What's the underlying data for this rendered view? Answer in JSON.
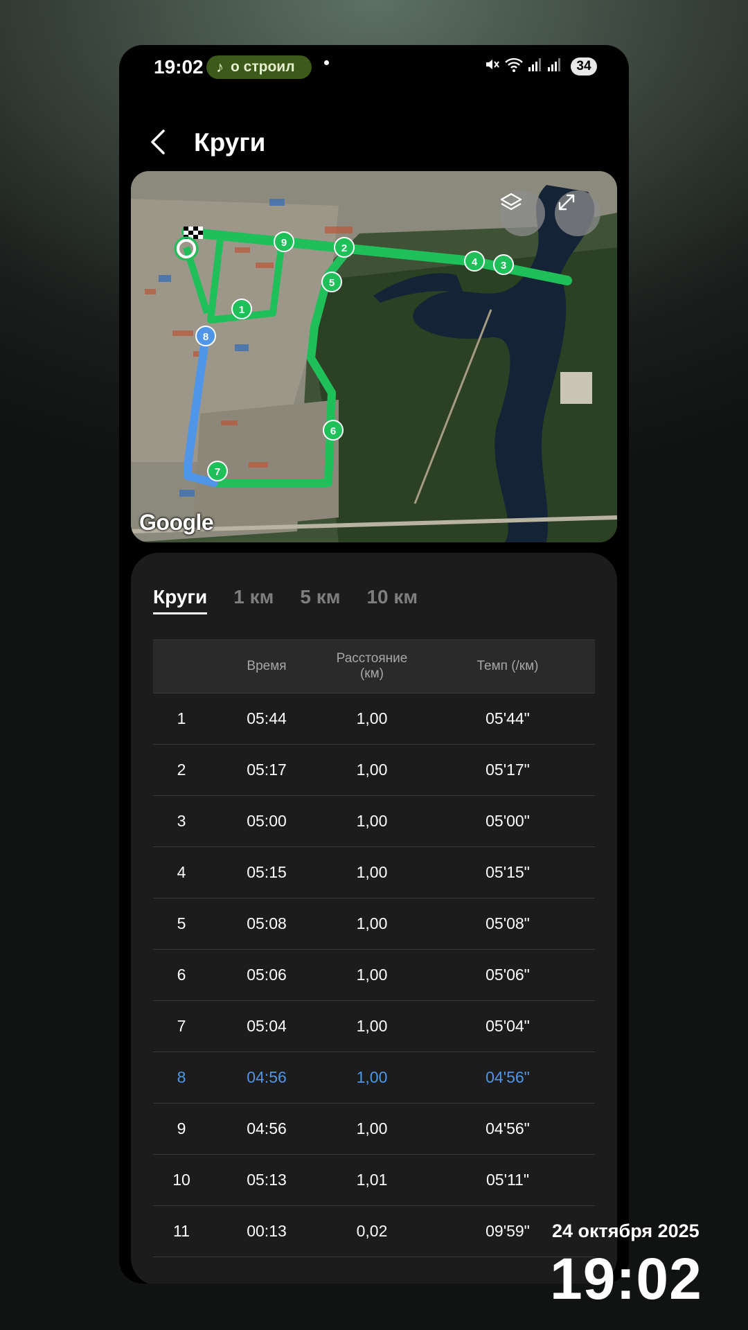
{
  "status_bar": {
    "time": "19:02",
    "media_pill": "о строил",
    "battery": "34",
    "icons": [
      "mute-icon",
      "wifi-icon",
      "signal-icon",
      "signal-icon"
    ]
  },
  "header": {
    "title": "Круги"
  },
  "map": {
    "logo": "Google",
    "buttons": [
      "layers-icon",
      "expand-icon"
    ],
    "lap_markers": [
      "1",
      "2",
      "3",
      "4",
      "5",
      "6",
      "7",
      "8",
      "9"
    ],
    "route_color": "#1fbf5a",
    "highlight_color": "#4f96e8"
  },
  "tabs": [
    {
      "label": "Круги",
      "active": true
    },
    {
      "label": "1 км",
      "active": false
    },
    {
      "label": "5 км",
      "active": false
    },
    {
      "label": "10 км",
      "active": false
    }
  ],
  "table": {
    "columns": [
      "",
      "Время",
      "Расстояние (км)",
      "Темп (/км)"
    ],
    "rows": [
      [
        "1",
        "05:44",
        "1,00",
        "05'44\""
      ],
      [
        "2",
        "05:17",
        "1,00",
        "05'17\""
      ],
      [
        "3",
        "05:00",
        "1,00",
        "05'00\""
      ],
      [
        "4",
        "05:15",
        "1,00",
        "05'15\""
      ],
      [
        "5",
        "05:08",
        "1,00",
        "05'08\""
      ],
      [
        "6",
        "05:06",
        "1,00",
        "05'06\""
      ],
      [
        "7",
        "05:04",
        "1,00",
        "05'04\""
      ],
      [
        "8",
        "04:56",
        "1,00",
        "04'56\""
      ],
      [
        "9",
        "04:56",
        "1,00",
        "04'56\""
      ],
      [
        "10",
        "05:13",
        "1,01",
        "05'11\""
      ],
      [
        "11",
        "00:13",
        "0,02",
        "09'59\""
      ]
    ],
    "highlighted_row": 8
  },
  "overlay": {
    "date": "24 октября 2025",
    "time": "19:02"
  }
}
